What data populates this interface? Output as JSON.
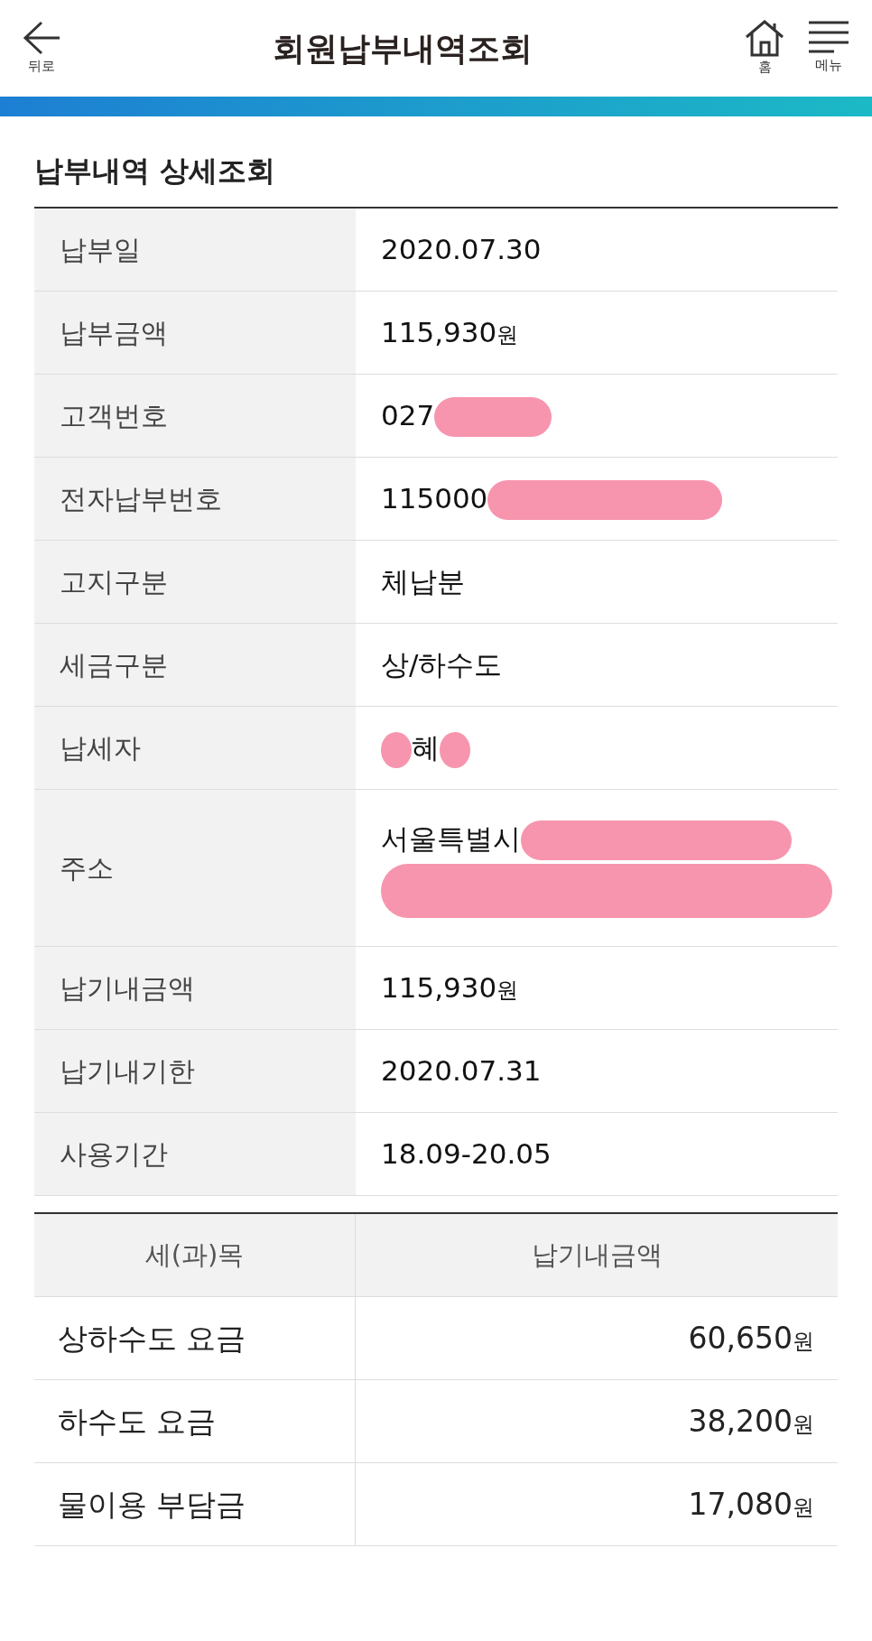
{
  "header": {
    "back_label": "뒤로",
    "title": "회원납부내역조회",
    "home_label": "홈",
    "menu_label": "메뉴"
  },
  "section_title": "납부내역 상세조회",
  "details": [
    {
      "label": "납부일",
      "value": "2020.07.30",
      "kind": "text"
    },
    {
      "label": "납부금액",
      "value": "115,930",
      "unit": "원",
      "kind": "text"
    },
    {
      "label": "고객번호",
      "value": "027",
      "kind": "redacted"
    },
    {
      "label": "전자납부번호",
      "value": "115000",
      "kind": "redacted"
    },
    {
      "label": "고지구분",
      "value": "체납분",
      "kind": "text"
    },
    {
      "label": "세금구분",
      "value": "상/하수도",
      "kind": "text"
    },
    {
      "label": "납세자",
      "value": "혜",
      "kind": "name"
    },
    {
      "label": "주소",
      "value": "서울특별시",
      "kind": "address"
    },
    {
      "label": "납기내금액",
      "value": "115,930",
      "unit": "원",
      "kind": "text"
    },
    {
      "label": "납기내기한",
      "value": "2020.07.31",
      "kind": "text"
    },
    {
      "label": "사용기간",
      "value": "18.09-20.05",
      "kind": "text"
    }
  ],
  "breakdown": {
    "columns": [
      "세(과)목",
      "납기내금액"
    ],
    "rows": [
      {
        "item": "상하수도 요금",
        "amount": "60,650",
        "unit": "원"
      },
      {
        "item": "하수도 요금",
        "amount": "38,200",
        "unit": "원"
      },
      {
        "item": "물이용 부담금",
        "amount": "17,080",
        "unit": "원"
      }
    ]
  }
}
